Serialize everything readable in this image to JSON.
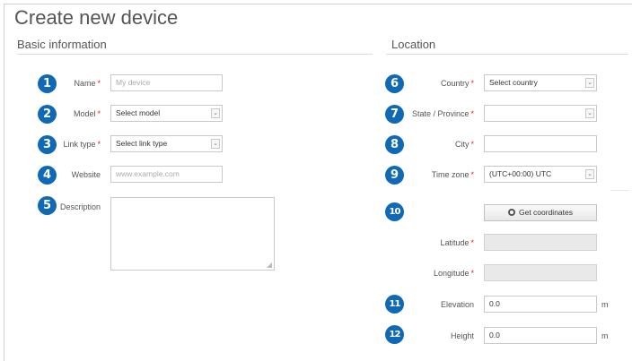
{
  "page": {
    "title": "Create new device"
  },
  "basic": {
    "title": "Basic information",
    "fields": [
      {
        "num": "1",
        "label": "Name",
        "required": "*",
        "value": "My device"
      },
      {
        "num": "2",
        "label": "Model",
        "required": "*",
        "value": "Select model"
      },
      {
        "num": "3",
        "label": "Link type",
        "required": "*",
        "value": "Select link type"
      },
      {
        "num": "4",
        "label": "Website",
        "required": "",
        "value": "www.example.com"
      },
      {
        "num": "5",
        "label": "Description",
        "required": "",
        "value": ""
      }
    ]
  },
  "location": {
    "title": "Location",
    "fields": [
      {
        "num": "6",
        "label": "Country",
        "required": "*",
        "value": "Select country"
      },
      {
        "num": "7",
        "label": "State / Province",
        "required": "*",
        "value": ""
      },
      {
        "num": "8",
        "label": "City",
        "required": "*",
        "value": ""
      },
      {
        "num": "9",
        "label": "Time zone",
        "required": "*",
        "value": "(UTC+00:00) UTC"
      },
      {
        "num": "10",
        "button": "Get coordinates"
      },
      {
        "label": "Latitude",
        "required": "*",
        "value": ""
      },
      {
        "label": "Longitude",
        "required": "*",
        "value": ""
      },
      {
        "num": "11",
        "label": "Elevation",
        "required": "",
        "value": "0.0",
        "unit": "m"
      },
      {
        "num": "12",
        "label": "Height",
        "required": "",
        "value": "0.0",
        "unit": "m"
      }
    ]
  },
  "icons": {
    "select_arrow": "chevron-down-icon",
    "globe": "globe-icon",
    "resize": "resize-grip-icon"
  },
  "colors": {
    "badge": "#1069b5",
    "required": "#d9262c"
  }
}
